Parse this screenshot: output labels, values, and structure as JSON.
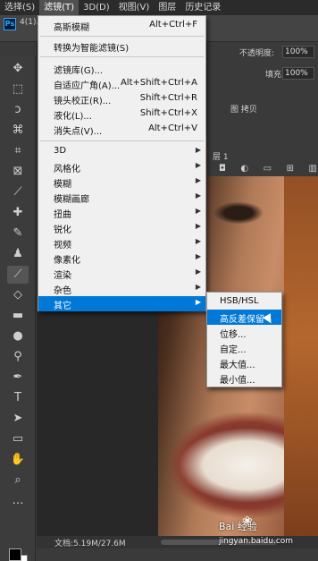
{
  "menubar": {
    "items": [
      "选择(S)",
      "滤镜(T)",
      "3D(D)",
      "视图(V)",
      "图层",
      "历史记录"
    ],
    "active_index": 1
  },
  "document": {
    "tab_label": "4(1).",
    "logo": "Ps"
  },
  "options": {
    "opacity_label": "不透明度:",
    "opacity_value": "100%",
    "fill_label": "填充:",
    "fill_value": "100%",
    "panel_text": "图 拷贝",
    "layer_text": "层 1"
  },
  "filter_menu": {
    "items": [
      {
        "label": "高斯模糊",
        "shortcut": "Alt+Ctrl+F"
      },
      {
        "label": "转换为智能滤镜(S)",
        "shortcut": ""
      },
      {
        "label": "滤镜库(G)...",
        "shortcut": ""
      },
      {
        "label": "自适应广角(A)...",
        "shortcut": "Alt+Shift+Ctrl+A"
      },
      {
        "label": "镜头校正(R)...",
        "shortcut": "Shift+Ctrl+R"
      },
      {
        "label": "液化(L)...",
        "shortcut": "Shift+Ctrl+X"
      },
      {
        "label": "消失点(V)...",
        "shortcut": "Alt+Ctrl+V"
      },
      {
        "label": "3D",
        "shortcut": ""
      },
      {
        "label": "风格化",
        "shortcut": ""
      },
      {
        "label": "模糊",
        "shortcut": ""
      },
      {
        "label": "模糊画廊",
        "shortcut": ""
      },
      {
        "label": "扭曲",
        "shortcut": ""
      },
      {
        "label": "锐化",
        "shortcut": ""
      },
      {
        "label": "视频",
        "shortcut": ""
      },
      {
        "label": "像素化",
        "shortcut": ""
      },
      {
        "label": "渲染",
        "shortcut": ""
      },
      {
        "label": "杂色",
        "shortcut": ""
      },
      {
        "label": "其它",
        "shortcut": ""
      }
    ],
    "highlighted": "其它"
  },
  "other_submenu": {
    "items": [
      "HSB/HSL",
      "高反差保留",
      "位移...",
      "自定...",
      "最大值...",
      "最小值..."
    ],
    "highlighted": "高反差保留"
  },
  "status": {
    "doc_info": "文档:5.19M/27.6M"
  },
  "watermark": {
    "brand": "Bai  经验",
    "url": "jingyan.baidu.com"
  },
  "colors": {
    "menu_bg": "#f0f0f0",
    "highlight": "#0078d7",
    "app_bg": "#3a3a3a",
    "menubar_bg": "#2b2b2b"
  }
}
